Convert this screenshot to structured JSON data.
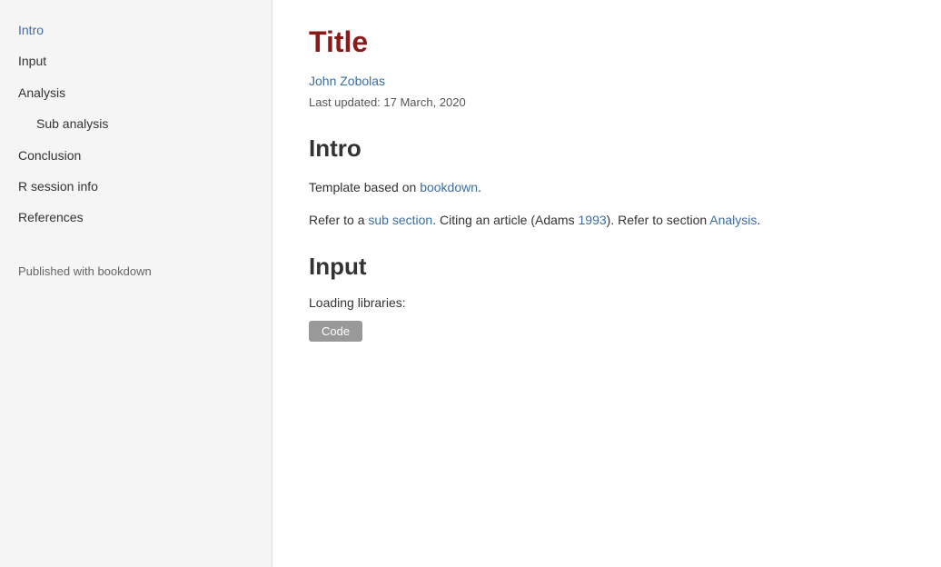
{
  "sidebar": {
    "items": [
      {
        "label": "Intro",
        "id": "intro",
        "active": true,
        "sub": false
      },
      {
        "label": "Input",
        "id": "input",
        "active": false,
        "sub": false
      },
      {
        "label": "Analysis",
        "id": "analysis",
        "active": false,
        "sub": false
      },
      {
        "label": "Sub analysis",
        "id": "sub-analysis",
        "active": false,
        "sub": true
      },
      {
        "label": "Conclusion",
        "id": "conclusion",
        "active": false,
        "sub": false
      },
      {
        "label": "R session info",
        "id": "r-session-info",
        "active": false,
        "sub": false
      },
      {
        "label": "References",
        "id": "references",
        "active": false,
        "sub": false
      }
    ],
    "footer": "Published with bookdown"
  },
  "main": {
    "title": "Title",
    "author": "John Zobolas",
    "date": "Last updated: 17 March, 2020",
    "intro_heading": "Intro",
    "intro_p1_before": "Template based on ",
    "intro_p1_link": "bookdown",
    "intro_p1_after": ".",
    "intro_p2_before": "Refer to a ",
    "intro_p2_link1": "sub section",
    "intro_p2_middle": ". Citing an article (Adams ",
    "intro_p2_link2": "1993",
    "intro_p2_after": "). Refer to section ",
    "intro_p2_link3": "Analysis",
    "intro_p2_end": ".",
    "input_heading": "Input",
    "loading_text": "Loading libraries:",
    "code_button": "Code"
  }
}
